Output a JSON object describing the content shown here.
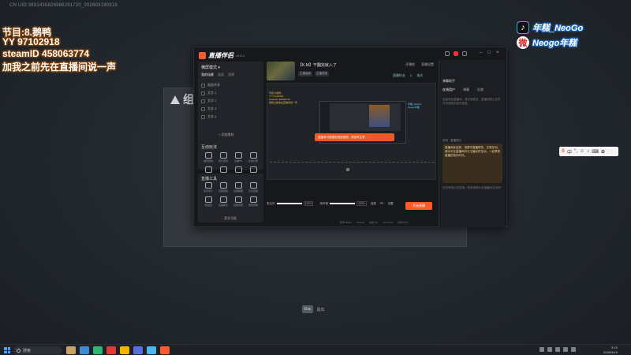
{
  "overlay": {
    "cn_uid": "CN UID:3831435826986291720_202603190319",
    "lines": [
      "节目:8.鹅鸭",
      "YY 97102918",
      "steamID 458063774",
      "加我之前先在直播间说一声"
    ],
    "social": [
      {
        "icon": "tiktok-icon",
        "glyph": "♪",
        "name": "年糕_NeoGo"
      },
      {
        "icon": "weibo-icon",
        "glyph": "微",
        "name": "Neogo年糕"
      }
    ]
  },
  "background_window": {
    "title": "组团"
  },
  "app": {
    "name": "直播伴侣",
    "version": "v9.8.4",
    "left": {
      "mode": "横屏模式 ▾",
      "tabs": [
        "我的场景",
        "画面",
        "直播"
      ],
      "sources": [
        "画面共享",
        "文字 1",
        "文字 2",
        "文本 3",
        "文本 4"
      ],
      "add_source": "+ 添加素材",
      "section1": "互动玩法",
      "section2": "直播工具",
      "grid1": [
        "语音连线",
        "观众连线",
        "主播PK",
        "礼物心愿",
        "弹幕互动",
        "合集口袋",
        "红包抽奖",
        "弹幕点赞"
      ],
      "grid2": [
        "任务中心",
        "直播回放",
        "直播提醒",
        "正在直播",
        "粉丝团",
        "直播助手",
        "回放剪辑",
        "屏幕录制"
      ],
      "more": "··· 更多功能"
    },
    "center": {
      "stream_title": "【K.M】干翻完就入了",
      "tags": [
        "主播画面",
        "主播语音"
      ],
      "top_info": [
        "开播前",
        "直播设置"
      ],
      "stats": [
        "直播时长",
        "0",
        "场次"
      ],
      "preview_text": "节目:8.鹅鸭\nYY 97102918\nsteamID 458063774\n加我之前先在直播间说一声",
      "preview_badge": "年糕_NeoGo\nNeogo年糕",
      "preview_alert": "直播有可能被检测到违规，请及时注意~",
      "controls": {
        "mic_label": "麦克风",
        "mic_pct": "100%",
        "speaker_label": "扬声器",
        "speaker_pct": "100%",
        "buttons": [
          "连麦",
          "PK",
          "设置"
        ]
      },
      "start_button": "开始直播",
      "status": [
        "码率:0kbps",
        "FPS:30",
        "丢帧:0%",
        "CPU:21%",
        "内存:55%"
      ]
    },
    "right": {
      "header": "弹幕助手",
      "tabs": [
        "在线用户",
        "弹幕",
        "礼物"
      ],
      "hint": "欢迎来到直播间，请文明发言，直播间禁止发布任何违规内容与信息。",
      "note": "系统 · 直播提示",
      "bubble": "直播间欢迎您，请遵守直播规范，文明互动。观众可在直播间内与主播实时互动，一起享受直播的快乐时光。",
      "bubble2": "还没有观众发言哦，快邀请观众来直播间互动吧~"
    }
  },
  "esc": {
    "key": "Esc",
    "label": "退出"
  },
  "taskbar": {
    "search": "搜索",
    "time": "3:19",
    "date": "2026/3/19"
  },
  "colors": {
    "accent": "#ff5a2c",
    "overlay_orange": "#ff8a1e",
    "overlay_blue": "#1565c0"
  }
}
